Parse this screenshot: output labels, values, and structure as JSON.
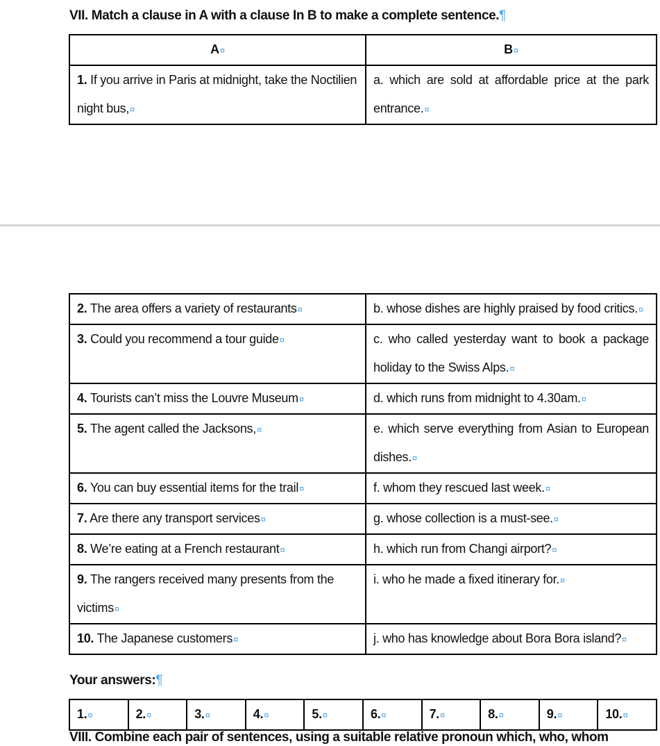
{
  "section7": {
    "title": "VII. Match a clause in A with a clause In B to make a complete sentence.",
    "col_a": "A",
    "col_b": "B",
    "rows": [
      {
        "num": "1.",
        "a": "If you arrive in Paris at midnight, take the Noctilien night bus,",
        "b": "a. which are sold at affordable price at the park entrance."
      },
      {
        "num": "2.",
        "a": "The area offers a variety of restaurants",
        "b": "b. whose dishes are highly praised by food critics."
      },
      {
        "num": "3.",
        "a": "Could you recommend a tour guide",
        "b": "c. who called yesterday want to book a package holiday to the Swiss Alps."
      },
      {
        "num": "4.",
        "a": "Tourists can’t miss the Louvre Museum",
        "b": "d. which runs from midnight to 4.30am."
      },
      {
        "num": "5.",
        "a": "The agent called the Jacksons,",
        "b": "e. which serve everything from Asian to European dishes."
      },
      {
        "num": "6.",
        "a": "You can buy essential items for the trail",
        "b": "f. whom they rescued last week."
      },
      {
        "num": "7.",
        "a": "Are there any transport services",
        "b": "g. whose collection is a must-see."
      },
      {
        "num": "8.",
        "a": "We’re eating at a French restaurant",
        "b": "h. which run from Changi airport?"
      },
      {
        "num": "9.",
        "a": "The rangers received many presents from the victims",
        "b": "i. who he made a fixed itinerary for."
      },
      {
        "num": "10.",
        "a": "The Japanese customers",
        "b": "j. who has knowledge about Bora Bora island?"
      }
    ],
    "answers_label": "Your answers:",
    "answers": [
      "1.",
      "2.",
      "3.",
      "4.",
      "5.",
      "6.",
      "7.",
      "8.",
      "9.",
      "10."
    ]
  },
  "section8": {
    "title": "VIII. Combine each pair of sentences, using a suitable relative pronoun which, who, whom"
  }
}
